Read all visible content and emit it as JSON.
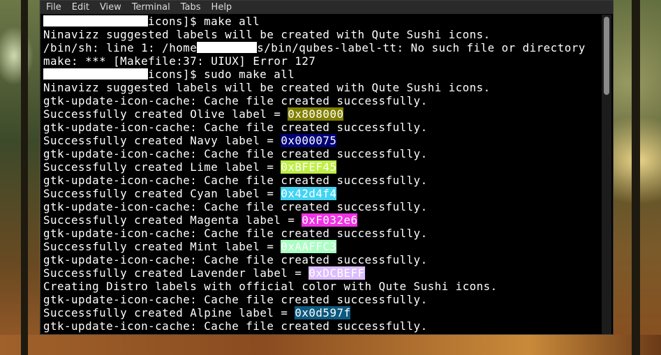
{
  "menu": [
    "File",
    "Edit",
    "View",
    "Terminal",
    "Tabs",
    "Help"
  ],
  "lines": [
    {
      "pre": "",
      "redact": 150,
      "text": "icons]$ make all"
    },
    {
      "text": "Ninavizz suggested labels will be created with Qute Sushi icons."
    },
    {
      "text": "/bin/sh: line 1: /home",
      "redact": 86,
      "post": "s/bin/qubes-label-tt: No such file or directory"
    },
    {
      "text": "make: *** [Makefile:37: UIUX] Error 127"
    },
    {
      "pre": "",
      "redact": 150,
      "text": "icons]$ sudo make all"
    },
    {
      "text": "Ninavizz suggested labels will be created with Qute Sushi icons."
    },
    {
      "text": "gtk-update-icon-cache: Cache file created successfully."
    },
    {
      "text": "Successfully created Olive label = ",
      "hex": "0x808000",
      "bg": "#808000",
      "fg": "#ffffff"
    },
    {
      "text": "gtk-update-icon-cache: Cache file created successfully."
    },
    {
      "text": "Successfully created Navy label = ",
      "hex": "0x000075",
      "bg": "#000075",
      "fg": "#ffffff"
    },
    {
      "text": "gtk-update-icon-cache: Cache file created successfully."
    },
    {
      "text": "Successfully created Lime label = ",
      "hex": "0xBFEF45",
      "bg": "#BFEF45",
      "fg": "#ffffff"
    },
    {
      "text": "gtk-update-icon-cache: Cache file created successfully."
    },
    {
      "text": "Successfully created Cyan label = ",
      "hex": "0x42d4f4",
      "bg": "#42d4f4",
      "fg": "#ffffff"
    },
    {
      "text": "gtk-update-icon-cache: Cache file created successfully."
    },
    {
      "text": "Successfully created Magenta label = ",
      "hex": "0xF032e6",
      "bg": "#F032e6",
      "fg": "#ffffff"
    },
    {
      "text": "gtk-update-icon-cache: Cache file created successfully."
    },
    {
      "text": "Successfully created Mint label = ",
      "hex": "0xAAFFC3",
      "bg": "#AAFFC3",
      "fg": "#ffffff"
    },
    {
      "text": "gtk-update-icon-cache: Cache file created successfully."
    },
    {
      "text": "Successfully created Lavender label = ",
      "hex": "0xDCBEFF",
      "bg": "#DCBEFF",
      "fg": "#ffffff"
    },
    {
      "text": "Creating Distro labels with official color with Qute Sushi icons."
    },
    {
      "text": "gtk-update-icon-cache: Cache file created successfully."
    },
    {
      "text": "Successfully created Alpine label = ",
      "hex": "0x0d597f",
      "bg": "#0d597f",
      "fg": "#ffffff"
    },
    {
      "text": "gtk-update-icon-cache: Cache file created successfully."
    }
  ],
  "colors": {
    "terminal_bg": "#000000",
    "terminal_fg": "#ffffff",
    "menubar_bg": "#2a2a2a"
  }
}
